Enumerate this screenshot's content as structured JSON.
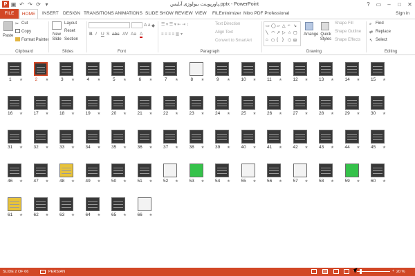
{
  "app": {
    "title": "پاورپوینت بیولوژی آبلیس.pptx - PowerPoint",
    "sign_in": "Sign in",
    "window_controls": [
      "?",
      "▭",
      "‒",
      "□",
      "✕"
    ],
    "colors": {
      "accent": "#d24726",
      "thumb": "#383838"
    }
  },
  "qat": [
    "↶",
    "↷",
    "⟳",
    "▾"
  ],
  "tabs": [
    "FILE",
    "HOME",
    "INSERT",
    "DESIGN",
    "TRANSITIONS",
    "ANIMATIONS",
    "SLIDE SHOW",
    "REVIEW",
    "VIEW",
    "FILEminimizer",
    "Nitro PDF Professional"
  ],
  "ribbon": {
    "clipboard": {
      "paste": "Paste",
      "cut": "Cut",
      "copy": "Copy",
      "format_painter": "Format Painter",
      "label": "Clipboard"
    },
    "slides": {
      "new_slide": "New Slide",
      "layout": "Layout",
      "reset": "Reset",
      "section": "Section",
      "label": "Slides"
    },
    "font": {
      "label": "Font",
      "row1": [
        "A",
        "A",
        "◆"
      ],
      "row2": [
        "B",
        "I",
        "U",
        "S",
        "abc",
        "AV",
        "Aa",
        "A"
      ]
    },
    "paragraph": {
      "text_direction": "Text Direction",
      "align_text": "Align Text",
      "convert": "Convert to SmartArt",
      "label": "Paragraph"
    },
    "drawing": {
      "arrange": "Arrange",
      "quick_styles": "Quick Styles",
      "shape_fill": "Shape Fill",
      "shape_outline": "Shape Outline",
      "shape_effects": "Shape Effects",
      "label": "Drawing",
      "shapes": [
        "▭",
        "◯",
        "▱",
        "△",
        "⌐",
        "↘",
        "╲",
        "⌒",
        "↗",
        "▷",
        "☆",
        "▢",
        "⌂",
        "⬠",
        "{",
        "}",
        "⬡",
        "⊞"
      ]
    },
    "editing": {
      "find": "Find",
      "replace": "Replace",
      "select": "Select",
      "label": "Editing"
    }
  },
  "slides": {
    "total": 66,
    "selected": 2,
    "star": "★",
    "special": {
      "8": "white",
      "48": "yellow",
      "52": "white",
      "53": "green",
      "55": "white",
      "57": "white",
      "59": "green",
      "61": "yellow",
      "66": "white"
    }
  },
  "status": {
    "slide": "SLIDE 2 OF 66",
    "language": "PERSIAN",
    "zoom": "20 %",
    "zoom_minus": "−",
    "zoom_plus": "+"
  }
}
